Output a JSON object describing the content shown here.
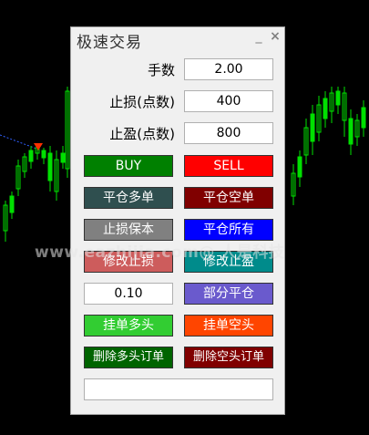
{
  "panel": {
    "title": "极速交易",
    "minimize_glyph": "_",
    "close_glyph": "×"
  },
  "fields": {
    "lots_label": "手数",
    "lots_value": "2.00",
    "stoploss_label": "止损(点数)",
    "stoploss_value": "400",
    "takeprofit_label": "止盈(点数)",
    "takeprofit_value": "800",
    "partial_value": "0.10",
    "comment_value": ""
  },
  "buttons": {
    "buy": "BUY",
    "sell": "SELL",
    "close_long": "平仓多单",
    "close_short": "平仓空单",
    "breakeven": "止损保本",
    "close_all": "平仓所有",
    "modify_sl": "修改止损",
    "modify_tp": "修改止盈",
    "partial_close": "部分平仓",
    "pending_long": "挂单多头",
    "pending_short": "挂单空头",
    "delete_long_orders": "删除多头订单",
    "delete_short_orders": "删除空头订单"
  },
  "colors": {
    "buy": "#008000",
    "sell": "#ff0000",
    "close_long": "#2f4f4f",
    "close_short": "#800000",
    "breakeven": "#808080",
    "close_all": "#0000ff",
    "modify_sl": "#cd5c5c",
    "modify_tp": "#008b8b",
    "partial_close": "#6a5acd",
    "pending_long": "#32cd32",
    "pending_short": "#ff4500",
    "delete_long_orders": "#006400",
    "delete_short_orders": "#800000"
  },
  "watermark": "www.eazhijia.com@ 人是科技"
}
